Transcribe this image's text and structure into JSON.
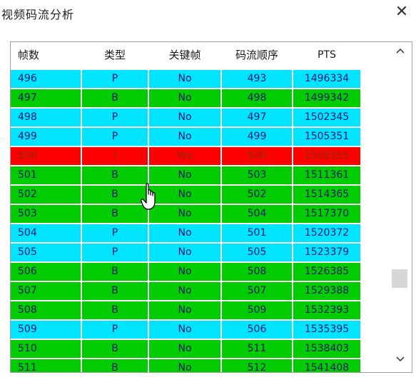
{
  "window": {
    "title": "视频码流分析",
    "close_glyph": "✕"
  },
  "columns": [
    "帧数",
    "类型",
    "关键帧",
    "码流顺序",
    "PTS"
  ],
  "colors": {
    "p_frame": "#00e4ff",
    "b_frame": "#00cc00",
    "i_frame": "#ff0000"
  },
  "rows": [
    {
      "frame": "496",
      "type": "P",
      "key": "No",
      "order": "493",
      "pts": "1496334"
    },
    {
      "frame": "497",
      "type": "B",
      "key": "No",
      "order": "498",
      "pts": "1499342"
    },
    {
      "frame": "498",
      "type": "P",
      "key": "No",
      "order": "497",
      "pts": "1502345"
    },
    {
      "frame": "499",
      "type": "P",
      "key": "No",
      "order": "499",
      "pts": "1505351"
    },
    {
      "frame": "500",
      "type": "I",
      "key": "Yes",
      "order": "500",
      "pts": "1508355"
    },
    {
      "frame": "501",
      "type": "B",
      "key": "No",
      "order": "503",
      "pts": "1511361"
    },
    {
      "frame": "502",
      "type": "B",
      "key": "No",
      "order": "502",
      "pts": "1514365"
    },
    {
      "frame": "503",
      "type": "B",
      "key": "No",
      "order": "504",
      "pts": "1517370"
    },
    {
      "frame": "504",
      "type": "P",
      "key": "No",
      "order": "501",
      "pts": "1520372"
    },
    {
      "frame": "505",
      "type": "P",
      "key": "No",
      "order": "505",
      "pts": "1523379"
    },
    {
      "frame": "506",
      "type": "B",
      "key": "No",
      "order": "508",
      "pts": "1526385"
    },
    {
      "frame": "507",
      "type": "B",
      "key": "No",
      "order": "507",
      "pts": "1529388"
    },
    {
      "frame": "508",
      "type": "B",
      "key": "No",
      "order": "509",
      "pts": "1532393"
    },
    {
      "frame": "509",
      "type": "P",
      "key": "No",
      "order": "506",
      "pts": "1535395"
    },
    {
      "frame": "510",
      "type": "B",
      "key": "No",
      "order": "511",
      "pts": "1538403"
    },
    {
      "frame": "511",
      "type": "B",
      "key": "No",
      "order": "512",
      "pts": "1541408"
    }
  ],
  "scrollbar": {
    "up_icon": "chevron-up-icon",
    "down_icon": "chevron-down-icon"
  },
  "cursor_icon": "hand-pointer-icon"
}
